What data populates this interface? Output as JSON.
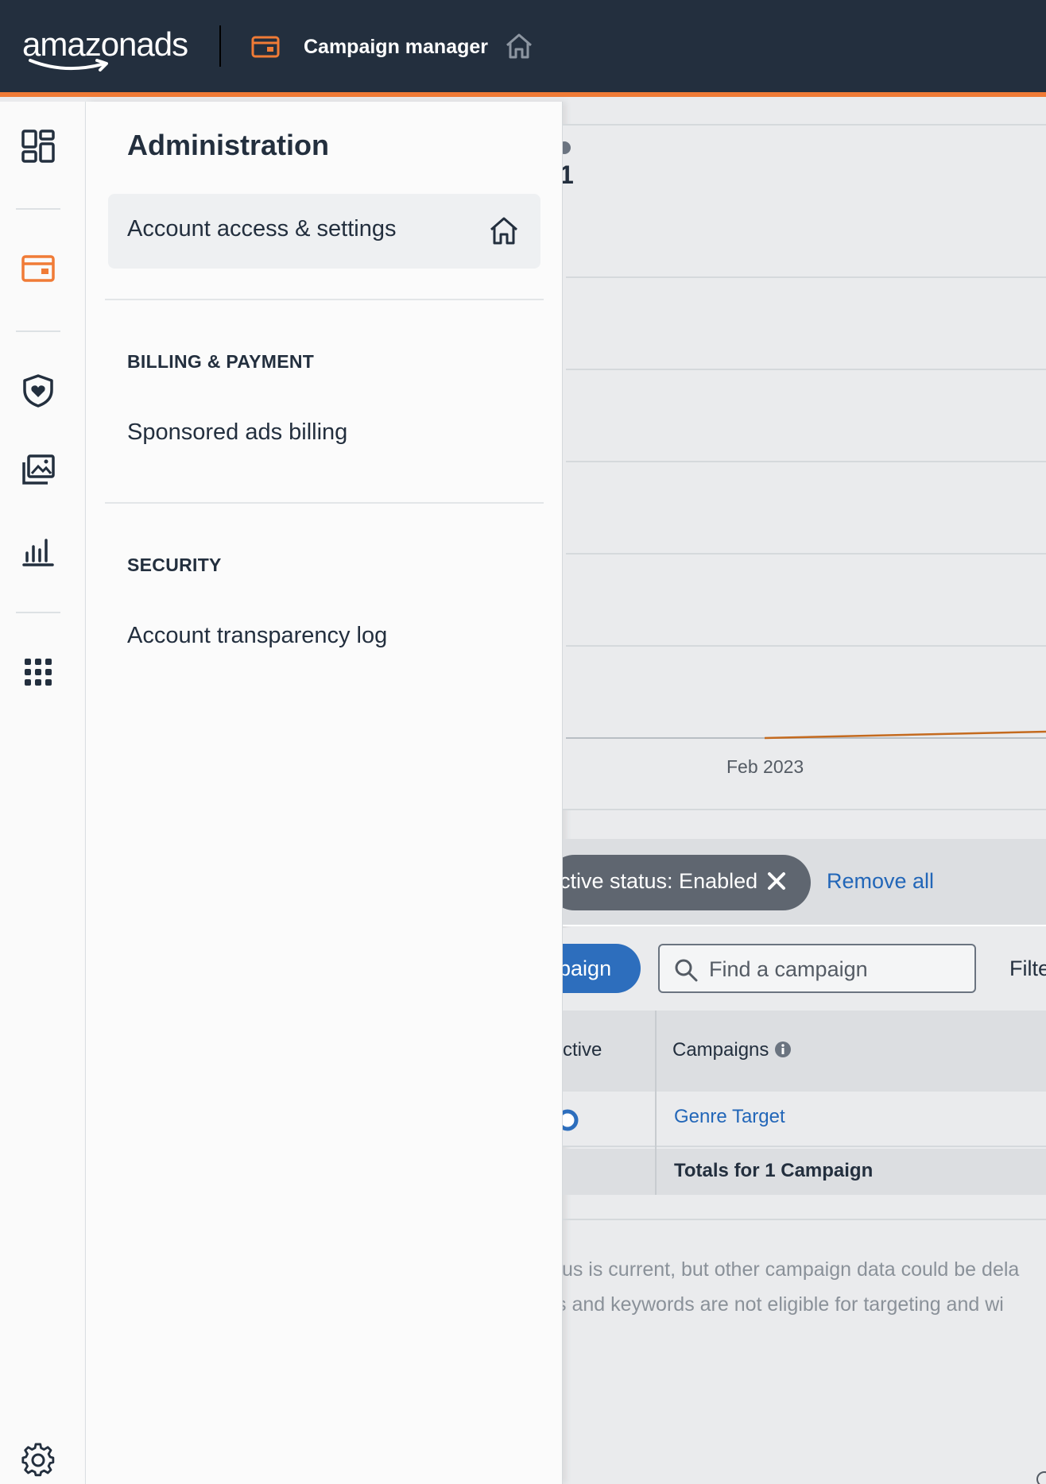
{
  "topbar": {
    "logo_text": "amazonads",
    "title": "Campaign manager",
    "brand_color": "#232f3e",
    "accent_color": "#f07b36"
  },
  "rail": {
    "icons": [
      "dashboard-icon",
      "campaign-manager-icon",
      "brand-safety-icon",
      "creative-assets-icon",
      "reports-icon",
      "apps-grid-icon",
      "settings-icon"
    ]
  },
  "panel": {
    "title": "Administration",
    "active_item": "Account access & settings",
    "sections": [
      {
        "heading": "BILLING & PAYMENT",
        "items": [
          "Sponsored ads billing"
        ]
      },
      {
        "heading": "SECURITY",
        "items": [
          "Account transparency log"
        ]
      }
    ]
  },
  "background": {
    "chart_fragment": "1",
    "x_tick": "Feb 2023",
    "filter_chip": "ctive status: Enabled",
    "remove_all": "Remove all",
    "create_button": "npaign",
    "search_placeholder": "Find a campaign",
    "filter_link": "Filte",
    "table": {
      "col_active": "ctive",
      "col_campaigns": "Campaigns",
      "row_campaign": "Genre Target",
      "totals": "Totals for 1 Campaign"
    },
    "footnotes": [
      "tus is current, but other campaign data could be dela",
      "s and keywords are not eligible for targeting and wi"
    ]
  }
}
